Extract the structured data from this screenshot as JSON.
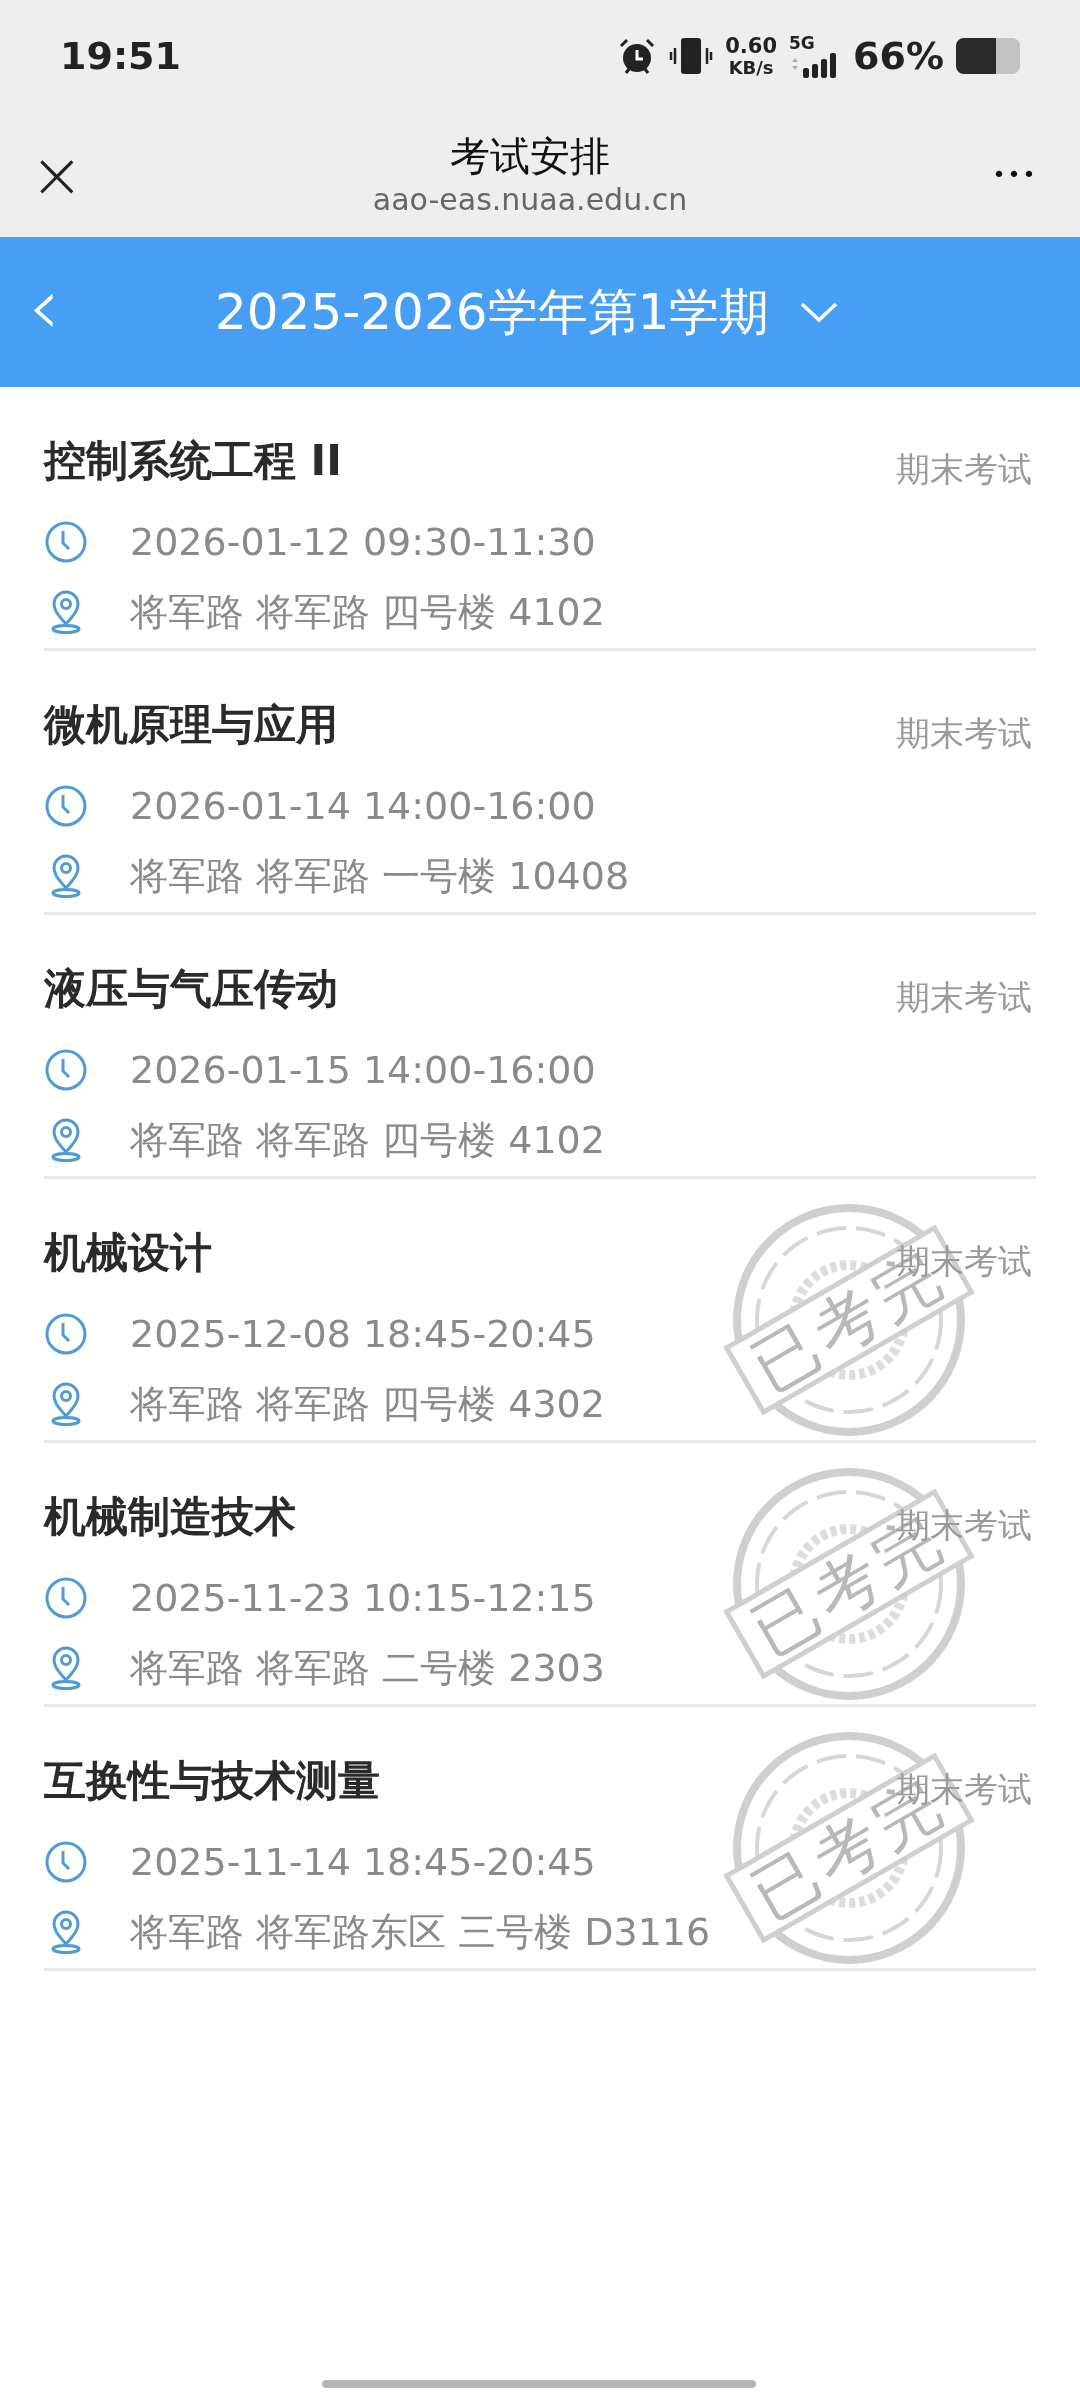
{
  "status_bar": {
    "time": "19:51",
    "net_speed_value": "0.60",
    "net_speed_unit": "KB/s",
    "network": "5G",
    "battery": "66%"
  },
  "title_bar": {
    "title": "考试安排",
    "url": "aao-eas.nuaa.edu.cn",
    "close": "×",
    "more": "•••"
  },
  "term_bar": {
    "back": "‹",
    "term": "2025-2026学年第1学期"
  },
  "exams": [
    {
      "course": "控制系统工程 II",
      "type": "期末考试",
      "time": "2026-01-12 09:30-11:30",
      "place": "将军路 将军路 四号楼 4102",
      "finished": false
    },
    {
      "course": "微机原理与应用",
      "type": "期末考试",
      "time": "2026-01-14 14:00-16:00",
      "place": "将军路 将军路 一号楼 10408",
      "finished": false
    },
    {
      "course": "液压与气压传动",
      "type": "期末考试",
      "time": "2026-01-15 14:00-16:00",
      "place": "将军路 将军路 四号楼 4102",
      "finished": false
    },
    {
      "course": "机械设计",
      "type": "期末考试",
      "time": "2025-12-08 18:45-20:45",
      "place": "将军路 将军路 四号楼 4302",
      "finished": true,
      "stamp": "已考完"
    },
    {
      "course": "机械制造技术",
      "type": "期末考试",
      "time": "2025-11-23 10:15-12:15",
      "place": "将军路 将军路 二号楼 2303",
      "finished": true,
      "stamp": "已考完"
    },
    {
      "course": "互换性与技术测量",
      "type": "期末考试",
      "time": "2025-11-14 18:45-20:45",
      "place": "将军路 将军路东区 三号楼 D3116",
      "finished": true,
      "stamp": "已考完"
    }
  ]
}
